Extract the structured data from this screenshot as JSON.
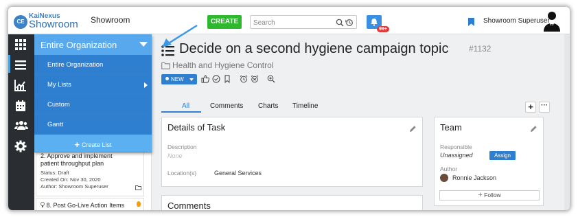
{
  "app": {
    "logo_top": "KaiNexus",
    "logo_bottom": "Showroom",
    "logo_mark": "CE",
    "org_name": "Showroom",
    "create_label": "CREATE",
    "search_placeholder": "Search",
    "notification_count": "99+",
    "username": "Showroom Superuser"
  },
  "dropdown": {
    "header": "Entire Organization",
    "items": [
      {
        "label": "Entire Organization"
      },
      {
        "label": "My Lists",
        "has_submenu": true
      },
      {
        "label": "Custom"
      },
      {
        "label": "Gantt"
      }
    ],
    "create_list": "Create List"
  },
  "list": {
    "card1": {
      "title_line1": "2. Approve and implement",
      "title_line2": "patient throughput plan",
      "status": "Status: Draft",
      "created": "Created On: Nov 30, 2020",
      "author": "Author: Showroom Superuser"
    },
    "card2": {
      "title": "8. Post Go-Live Action Items"
    }
  },
  "task": {
    "title": "Decide on a second hygiene campaign topic",
    "number": "#1132",
    "breadcrumb": "Health and Hygiene Control",
    "status": "NEW"
  },
  "tabs": [
    {
      "label": "All",
      "active": true
    },
    {
      "label": "Comments"
    },
    {
      "label": "Charts"
    },
    {
      "label": "Timeline"
    }
  ],
  "details": {
    "title": "Details of Task",
    "description_label": "Description",
    "description_value": "None",
    "location_label": "Location(s)",
    "location_value": "General Services"
  },
  "comments": {
    "title": "Comments"
  },
  "team": {
    "title": "Team",
    "responsible_label": "Responsible",
    "responsible_value": "Unassigned",
    "assign_label": "Assign",
    "author_label": "Author",
    "author_value": "Ronnie Jackson",
    "follow_label": "Follow"
  },
  "colors": {
    "accent": "#2f7fd1",
    "create_green": "#2eb82e",
    "dropdown_header": "#57a8ec",
    "rail": "#2a2d31",
    "badge_red": "#e03c3c"
  },
  "icons": {
    "rail": [
      "grid-icon",
      "list-icon",
      "chart-icon",
      "calendar-icon",
      "people-icon",
      "gear-icon"
    ]
  }
}
